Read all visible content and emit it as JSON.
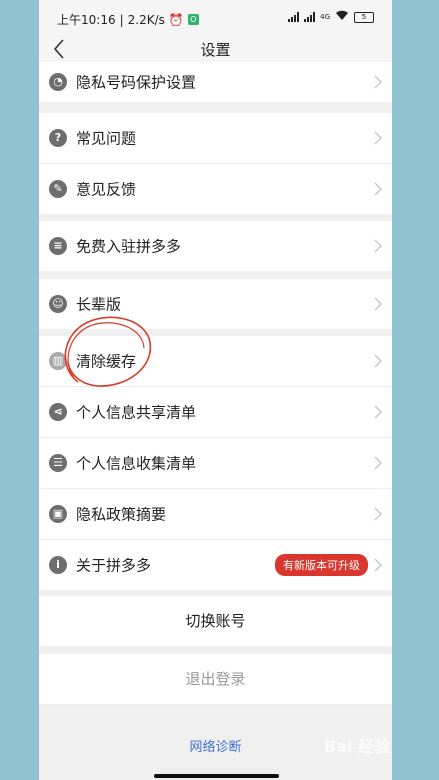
{
  "status_bar": {
    "time": "上午10:16",
    "separator": "|",
    "speed": "2.2K/s",
    "app_badge": "O",
    "network": "4G",
    "battery": "5"
  },
  "nav": {
    "title": "设置"
  },
  "items": {
    "privacy_number": "隐私号码保护设置",
    "faq": "常见问题",
    "feedback": "意见反馈",
    "merchant": "免费入驻拼多多",
    "elder_mode": "长辈版",
    "clear_cache": "清除缓存",
    "info_sharing": "个人信息共享清单",
    "info_collection": "个人信息收集清单",
    "privacy_summary": "隐私政策摘要",
    "about": "关于拼多多",
    "update_badge": "有新版本可升级"
  },
  "actions": {
    "switch_account": "切换账号",
    "logout": "退出登录",
    "network_diagnosis": "网络诊断"
  },
  "watermark": "Bai 经验",
  "colors": {
    "accent_red": "#d9362e",
    "link_blue": "#3f6fd0",
    "annotation_red": "#d83a2c"
  }
}
